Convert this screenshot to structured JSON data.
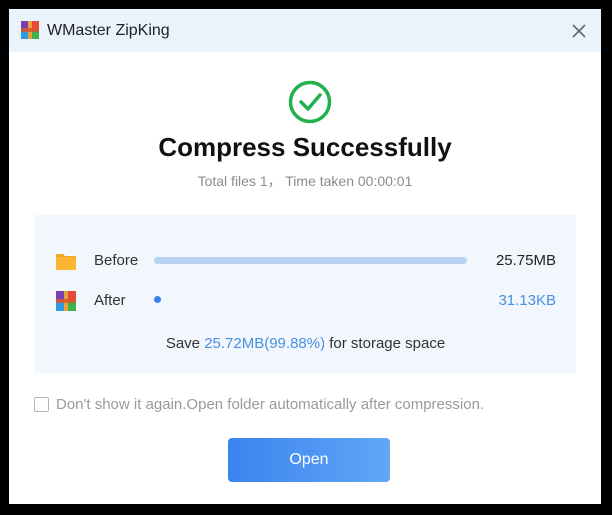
{
  "window": {
    "title": "WMaster ZipKing"
  },
  "result": {
    "headline": "Compress Successfully",
    "summary": "Total files 1， Time taken 00:00:01"
  },
  "comparison": {
    "before": {
      "label": "Before",
      "size": "25.75MB",
      "bar_fraction": 1.0
    },
    "after": {
      "label": "After",
      "size": "31.13KB",
      "bar_fraction": 0.0012
    },
    "save": {
      "prefix": "Save ",
      "amount": "25.72MB(99.88%)",
      "suffix": " for storage space"
    }
  },
  "options": {
    "dont_show_again": {
      "label": "Don't show it again.Open folder automatically after compression.",
      "checked": false
    }
  },
  "actions": {
    "open_label": "Open"
  },
  "colors": {
    "accent": "#3b82e6",
    "success": "#22b14c",
    "titlebar_bg": "#e9f3fc",
    "panel_bg": "#f1f7fd",
    "highlight_text": "#4a8fe0"
  },
  "icons": {
    "app": "archive-icon",
    "close": "close-icon",
    "success": "check-circle-icon",
    "before": "folder-icon",
    "after": "archive-icon"
  }
}
